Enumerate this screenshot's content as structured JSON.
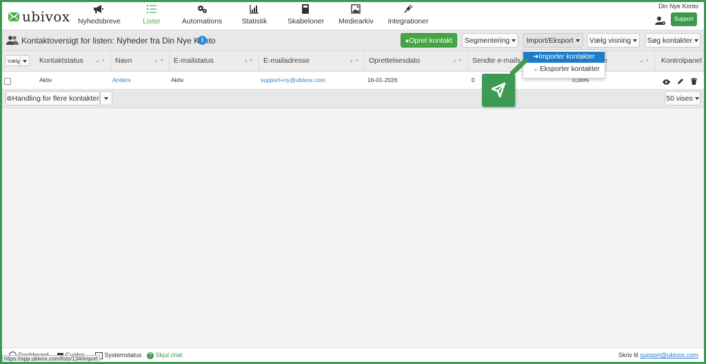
{
  "nav": {
    "logo": "ubivox",
    "items": [
      {
        "label": "Nyhedsbreve",
        "icon": "megaphone-icon"
      },
      {
        "label": "Lister",
        "icon": "list-icon"
      },
      {
        "label": "Automations",
        "icon": "gears-icon"
      },
      {
        "label": "Statistik",
        "icon": "bar-chart-icon"
      },
      {
        "label": "Skabeloner",
        "icon": "calculator-icon"
      },
      {
        "label": "Mediearkiv",
        "icon": "image-icon"
      },
      {
        "label": "Integrationer",
        "icon": "plug-icon"
      }
    ],
    "active_index": 1,
    "account": "Din Nye Konto",
    "support": "Support"
  },
  "header": {
    "title": "Kontaktoversigt for listen: Nyheder fra Din Nye Konto",
    "info": "i",
    "buttons": {
      "create": "Opret kontakt",
      "segment": "Segmentering",
      "import_export": "Import/Eksport",
      "view": "Vælg visning",
      "search": "Søg kontakter"
    }
  },
  "dropdown": {
    "items": [
      "➔Importer kontakter",
      "←Eksporter kontakter"
    ],
    "active_index": 0
  },
  "table": {
    "select_label": "Vælg",
    "columns": [
      "Kontaktstatus",
      "Navn",
      "E-mailstatus",
      "E-mailadresse",
      "Oprettelsesdato",
      "Sendte e-mails",
      "e",
      "Kontrolpanel"
    ],
    "rows": [
      {
        "status": "Aktiv",
        "name": "Anders",
        "email_status": "Aktiv",
        "email": "support+ny@ubivox.com",
        "created": "16-01-2026",
        "sent": "0",
        "rate": "0,00%"
      }
    ]
  },
  "footer": {
    "bulk_action": "Handling for flere kontakter",
    "per_page": "50 vises"
  },
  "bottom": {
    "links": [
      "Dashboard",
      "Guides",
      "Systemstatus",
      "Skjul chat"
    ],
    "write_to": "Skriv til",
    "email": "support@ubivox.com",
    "status_url": "https://app.ubivox.com/lists/134/import"
  },
  "colors": {
    "accent": "#4cae4c",
    "brand_green": "#3b9a4c",
    "link": "#2a7ec6",
    "dropdown_active": "#1e7bc8",
    "frame": "#3a9a4f"
  }
}
